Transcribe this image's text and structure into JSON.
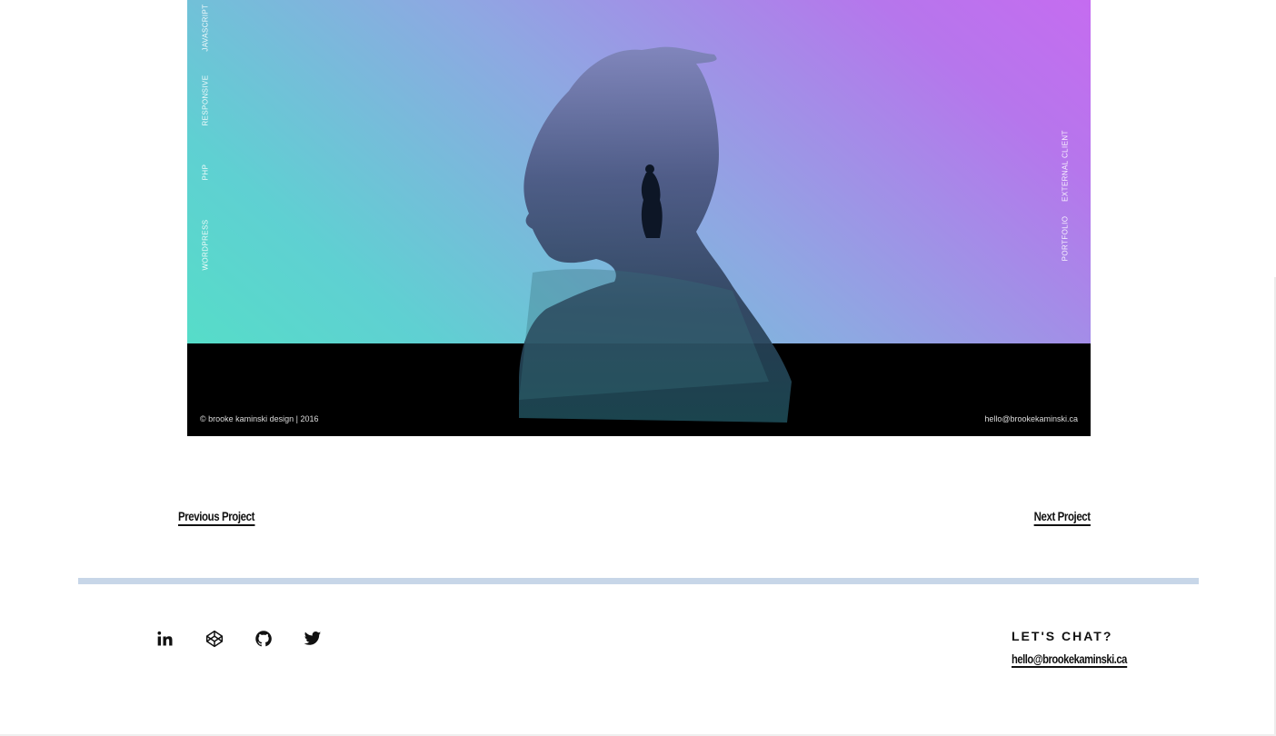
{
  "hero": {
    "left_tags": [
      "JavaScript",
      "Responsive",
      "PHP",
      "WordPress"
    ],
    "right_tags": [
      "External Client",
      "Portfolio"
    ],
    "copyright": "© brooke kaminski design | 2016",
    "email": "hello@brookekaminski.ca"
  },
  "nav": {
    "previous_label": "Previous Project",
    "next_label": "Next Project"
  },
  "footer": {
    "social": [
      {
        "name": "linkedin-icon"
      },
      {
        "name": "codepen-icon"
      },
      {
        "name": "github-icon"
      },
      {
        "name": "twitter-icon"
      }
    ],
    "chat_heading": "LET'S CHAT?",
    "chat_email": "hello@brookekaminski.ca"
  },
  "colors": {
    "divider": "#c7d6e8",
    "gradient_start": "#52e2c4",
    "gradient_end": "#c56cf0",
    "text": "#111111"
  }
}
